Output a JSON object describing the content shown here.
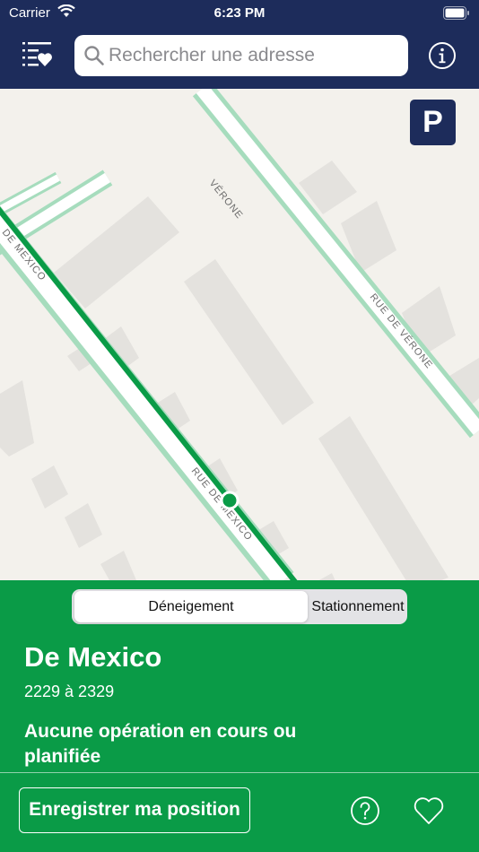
{
  "status_bar": {
    "carrier": "Carrier",
    "time": "6:23 PM"
  },
  "header": {
    "search_placeholder": "Rechercher une adresse",
    "icons": {
      "favorites_list": "favorites-list-icon",
      "search": "search-icon",
      "info": "info-icon"
    }
  },
  "map": {
    "parking_button_label": "P",
    "street_labels": [
      "VÉRONE",
      "RUE DE VÉRONE",
      "DE MEXICO",
      "RUE DE MEXICO"
    ],
    "highlight_color": "#0a9b47"
  },
  "panel": {
    "tabs": [
      {
        "label": "Déneigement",
        "selected": true
      },
      {
        "label": "Stationnement",
        "selected": false
      }
    ],
    "street_name": "De Mexico",
    "address_range": "2229 à 2329",
    "operation_status": "Aucune opération en cours ou planifiée",
    "save_position_label": "Enregistrer ma position",
    "background_color": "#0a9b47"
  },
  "colors": {
    "nav_bar": "#1d2c5b",
    "panel": "#0a9b47"
  }
}
